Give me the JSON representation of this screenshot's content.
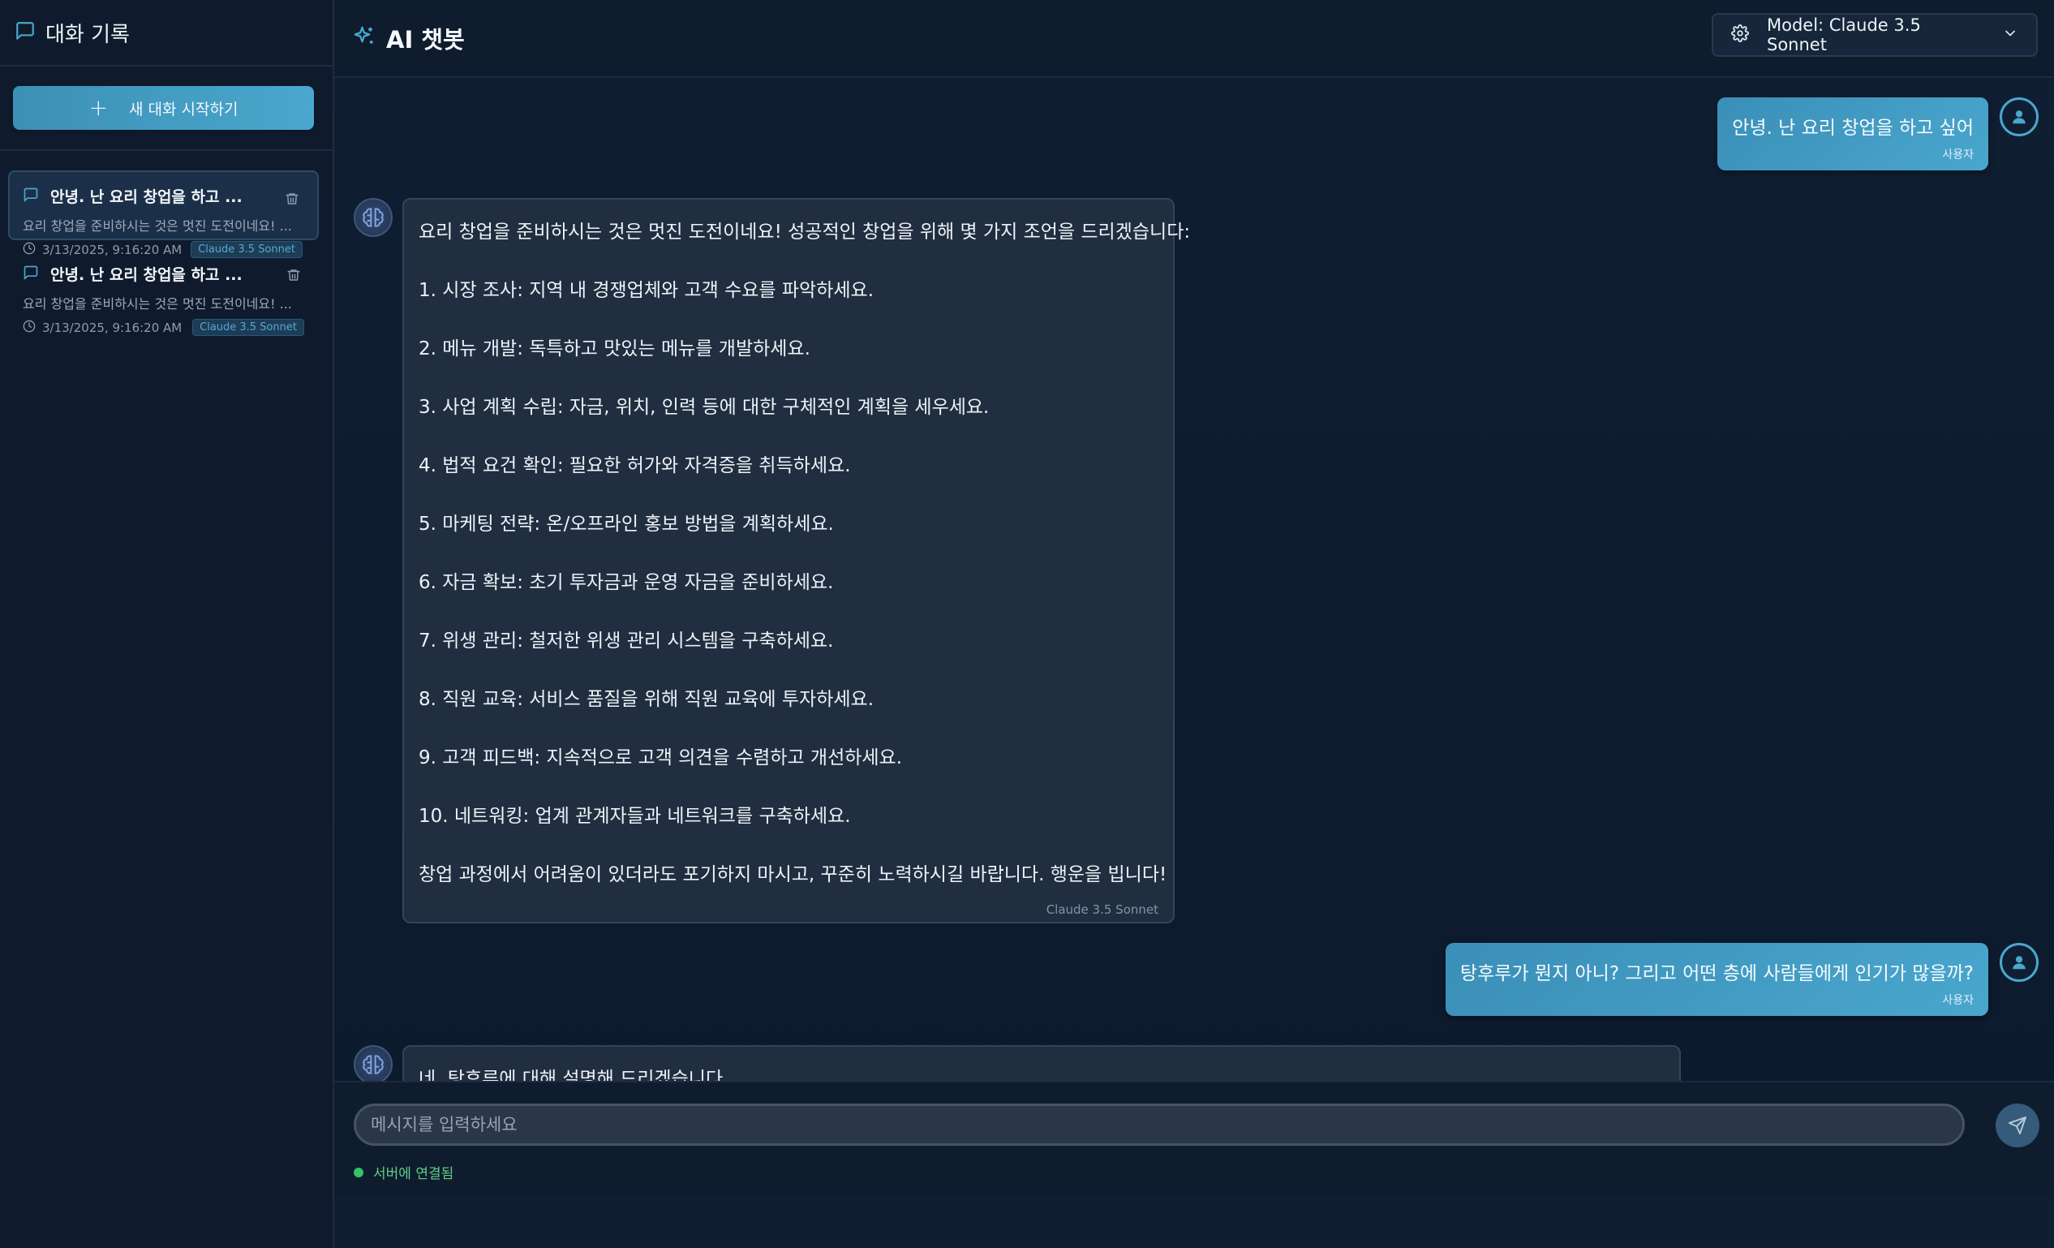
{
  "sidebar": {
    "title": "대화 기록",
    "new_chat_label": "새 대화 시작하기",
    "conversations": [
      {
        "title": "안녕. 난 요리 창업을 하고 ...",
        "preview": "요리 창업을 준비하시는 것은 멋진 도전이네요! ...",
        "date": "3/13/2025, 9:16:20 AM",
        "model": "Claude 3.5 Sonnet"
      },
      {
        "title": "안녕. 난 요리 창업을 하고 ...",
        "preview": "요리 창업을 준비하시는 것은 멋진 도전이네요! ...",
        "date": "3/13/2025, 9:16:20 AM",
        "model": "Claude 3.5 Sonnet"
      }
    ]
  },
  "header": {
    "title": "AI 챗봇",
    "model_select": "Model: Claude 3.5 Sonnet"
  },
  "messages": [
    {
      "role": "user",
      "text": "안녕. 난 요리 창업을 하고 싶어",
      "label": "사용자"
    },
    {
      "role": "bot",
      "lines": [
        "요리 창업을 준비하시는 것은 멋진 도전이네요! 성공적인 창업을 위해 몇 가지 조언을 드리겠습니다:",
        "1. 시장 조사: 지역 내 경쟁업체와 고객 수요를 파악하세요.",
        "2. 메뉴 개발: 독특하고 맛있는 메뉴를 개발하세요.",
        "3. 사업 계획 수립: 자금, 위치, 인력 등에 대한 구체적인 계획을 세우세요.",
        "4. 법적 요건 확인: 필요한 허가와 자격증을 취득하세요.",
        "5. 마케팅 전략: 온/오프라인 홍보 방법을 계획하세요.",
        "6. 자금 확보: 초기 투자금과 운영 자금을 준비하세요.",
        "7. 위생 관리: 철저한 위생 관리 시스템을 구축하세요.",
        "8. 직원 교육: 서비스 품질을 위해 직원 교육에 투자하세요.",
        "9. 고객 피드백: 지속적으로 고객 의견을 수렴하고 개선하세요.",
        "10. 네트워킹: 업계 관계자들과 네트워크를 구축하세요.",
        "창업 과정에서 어려움이 있더라도 포기하지 마시고, 꾸준히 노력하시길 바랍니다. 행운을 빕니다!"
      ],
      "model": "Claude 3.5 Sonnet"
    },
    {
      "role": "user",
      "text": "탕후루가 뭔지 아니? 그리고 어떤 층에 사람들에게 인기가 많을까?",
      "label": "사용자"
    },
    {
      "role": "bot",
      "lines": [
        "네, 탕후루에 대해 설명해 드리겠습니다."
      ]
    }
  ],
  "input": {
    "placeholder": "메시지를 입력하세요",
    "value": ""
  },
  "status": {
    "text": "서버에 연결됨",
    "color": "#36c26a"
  },
  "colors": {
    "accent": "#4aa7cd",
    "background": "#0e1a2b",
    "bot_bubble": "#212e40"
  },
  "icons": {
    "chat": "chat-bubble-icon",
    "sparkle": "sparkle-icon",
    "gear": "gear-icon",
    "chevron": "chevron-down-icon",
    "plus": "plus-icon",
    "trash": "trash-icon",
    "clock": "clock-icon",
    "user": "user-icon",
    "bot": "brain-icon",
    "send": "send-icon"
  }
}
